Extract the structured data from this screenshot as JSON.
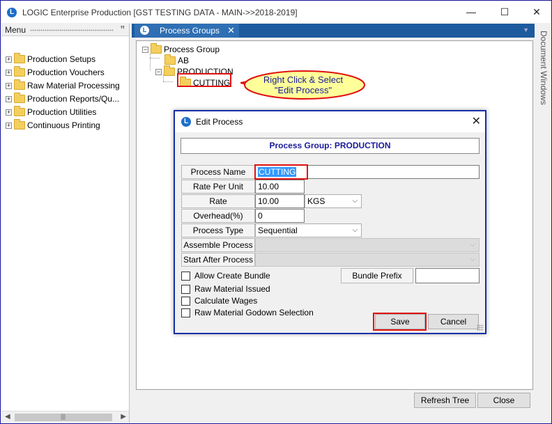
{
  "window": {
    "title": "LOGIC Enterprise Production  [GST TESTING DATA - MAIN->>2018-2019]",
    "logo_letter": "L",
    "minimize_glyph": "—",
    "maximize_glyph": "☐",
    "close_glyph": "✕"
  },
  "menu": {
    "title": "Menu",
    "pin_glyph": "ꟸ",
    "items": [
      {
        "label": "Production Setups"
      },
      {
        "label": "Production Vouchers"
      },
      {
        "label": "Raw Material Processing"
      },
      {
        "label": "Production  Reports/Qu..."
      },
      {
        "label": "Production Utilities"
      },
      {
        "label": "Continuous Printing"
      }
    ],
    "scroll_grip": "|||"
  },
  "tab": {
    "label": "Process Groups",
    "close_glyph": "✕",
    "logo_letter": "L",
    "dropdown_glyph": "▼"
  },
  "tree": {
    "root": "Process Group",
    "children": [
      {
        "label": "AB"
      },
      {
        "label": "PRODUCTION"
      },
      {
        "label": "CUTTING"
      }
    ]
  },
  "callout": {
    "line1": "Right Click & Select",
    "line2": "\"Edit Process\""
  },
  "bottom_buttons": {
    "refresh": "Refresh Tree",
    "close": "Close"
  },
  "doc_windows": {
    "label": "Document Windows"
  },
  "dialog": {
    "title": "Edit Process",
    "logo_letter": "L",
    "close_glyph": "✕",
    "group_banner": "Process Group: PRODUCTION",
    "fields": {
      "process_name": {
        "label": "Process Name",
        "value": "CUTTING"
      },
      "rate_per_unit": {
        "label": "Rate Per Unit",
        "value": "10.00"
      },
      "rate": {
        "label": "Rate",
        "value": "10.00",
        "unit": "KGS"
      },
      "overhead": {
        "label": "Overhead(%)",
        "value": "0"
      },
      "process_type": {
        "label": "Process Type",
        "value": "Sequential"
      },
      "assemble_process": {
        "label": "Assemble Process",
        "value": ""
      },
      "start_after_process": {
        "label": "Start After Process",
        "value": ""
      }
    },
    "checkboxes": {
      "allow_create_bundle": {
        "label": "Allow Create Bundle",
        "checked": false
      },
      "raw_material_issued": {
        "label": "Raw Material Issued",
        "checked": false
      },
      "calculate_wages": {
        "label": "Calculate Wages",
        "checked": false
      },
      "raw_material_godown_selection": {
        "label": "Raw Material Godown Selection",
        "checked": false
      }
    },
    "bundle_prefix": {
      "label": "Bundle Prefix",
      "value": ""
    },
    "buttons": {
      "save": "Save",
      "cancel": "Cancel"
    }
  },
  "colors": {
    "accent_blue": "#1d5b9e",
    "highlight_red": "#e01010",
    "callout_yellow": "#ffff99",
    "banner_text": "#1a1a99"
  }
}
